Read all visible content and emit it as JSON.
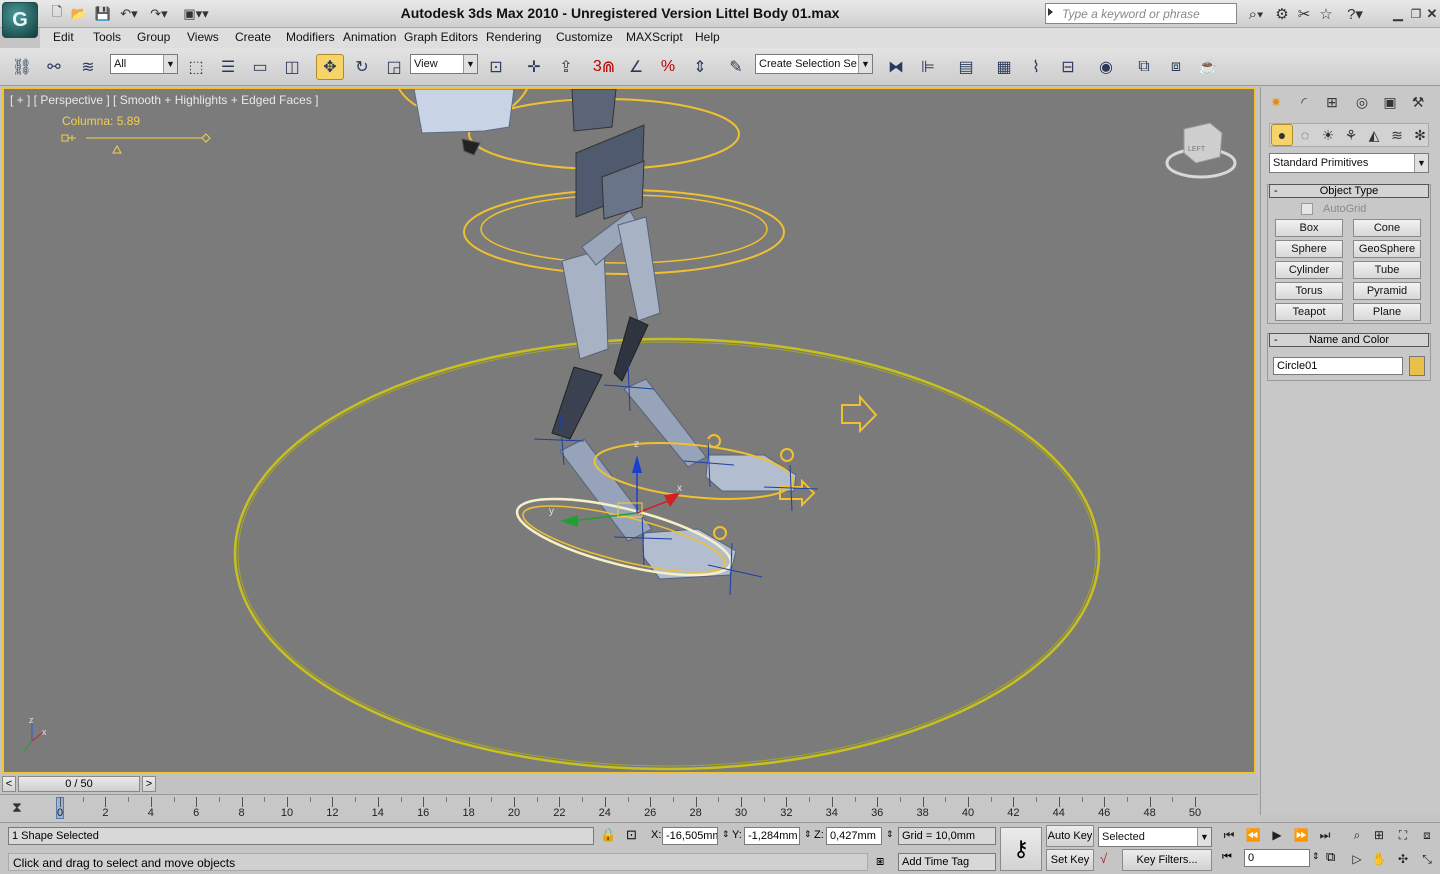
{
  "window": {
    "title": "Autodesk 3ds Max  2010   - Unregistered Version    Littel Body 01.max",
    "search_placeholder": "Type a keyword or phrase"
  },
  "menu": [
    "Edit",
    "Tools",
    "Group",
    "Views",
    "Create",
    "Modifiers",
    "Animation",
    "Graph Editors",
    "Rendering",
    "Customize",
    "MAXScript",
    "Help"
  ],
  "toolbar": {
    "selection_filter": "All",
    "reference_coord": "View",
    "named_selection": "Create Selection Se",
    "snap_3": "3",
    "percent": "%"
  },
  "viewport": {
    "label": "[ + ] [ Perspective ] [ Smooth + Highlights + Edged Faces ]",
    "parameter": "Columna: 5.89",
    "gizmo_labels": {
      "z": "z",
      "x": "x",
      "y": "y"
    },
    "viewcube_face": "LEFT",
    "wire_color": "#f0c030",
    "ground_circle_color": "#c8c020"
  },
  "command_panel": {
    "category": "Standard Primitives",
    "object_type_title": "Object Type",
    "autogrid": "AutoGrid",
    "buttons": [
      "Box",
      "Cone",
      "Sphere",
      "GeoSphere",
      "Cylinder",
      "Tube",
      "Torus",
      "Pyramid",
      "Teapot",
      "Plane"
    ],
    "name_color_title": "Name and Color",
    "object_name": "Circle01",
    "object_color": "#e8c04a",
    "minus": "-"
  },
  "timeline": {
    "frame_display": "0 / 50",
    "prev": "<",
    "next": ">",
    "ticks": [
      "0",
      "2",
      "4",
      "6",
      "8",
      "10",
      "12",
      "14",
      "16",
      "18",
      "20",
      "22",
      "24",
      "26",
      "28",
      "30",
      "32",
      "34",
      "36",
      "38",
      "40",
      "42",
      "44",
      "46",
      "48",
      "50"
    ]
  },
  "status": {
    "selection_info": "1 Shape Selected",
    "prompt": "Click and drag to select and move objects",
    "x_label": "X:",
    "x_value": "-16,505mm",
    "y_label": "Y:",
    "y_value": "-1,284mm",
    "z_label": "Z:",
    "z_value": "0,427mm",
    "grid": "Grid = 10,0mm",
    "add_time_tag": "Add Time Tag",
    "auto_key": "Auto Key",
    "set_key": "Set Key",
    "key_mode": "Selected",
    "key_filters": "Key Filters...",
    "current_frame": "0"
  }
}
